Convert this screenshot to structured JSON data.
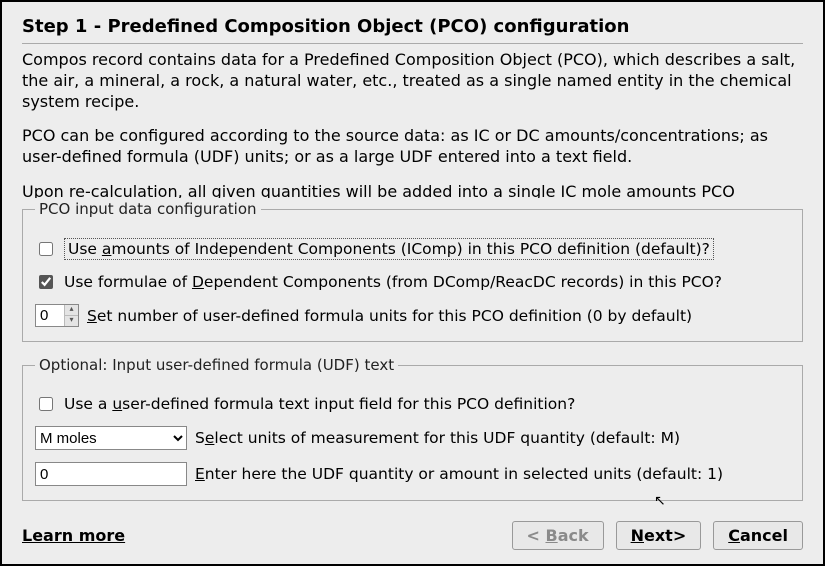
{
  "title": "Step 1 - Predefined Composition Object (PCO) configuration",
  "descr": {
    "p1": "Compos record contains data for a Predefined Composition Object (PCO), which describes a salt, the air, a mineral, a rock, a natural water, etc., treated  as a single named entity in the chemical system recipe.",
    "p2": "PCO can be configured according to the source data: as IC or DC amounts/concentrations; as user-defined formula (UDF) units; or as a large UDF entered into a text field.",
    "p3": "Upon re-calculation, all given quantities will be added into a single IC mole amounts PCO"
  },
  "group1": {
    "legend": "PCO input data configuration",
    "cb_amounts": {
      "checked": false,
      "pre": "Use ",
      "ukey": "a",
      "post": "mounts of Independent Components (IComp) in this PCO definition (default)?"
    },
    "cb_formulae": {
      "checked": true,
      "pre": "Use formulae of ",
      "ukey": "D",
      "post": "ependent Components (from DComp/ReacDC records) in this PCO?"
    },
    "spin": {
      "value": "0",
      "pre": "",
      "ukey": "S",
      "post": "et number of user-defined formula units for this PCO definition (0 by default)"
    }
  },
  "group2": {
    "legend": "Optional: Input user-defined formula (UDF) text",
    "cb_udf": {
      "checked": false,
      "pre": "Use a ",
      "ukey": "u",
      "post": "ser-defined formula text input field for this PCO definition?"
    },
    "units": {
      "selected": "M   moles",
      "pre": "S",
      "ukey": "e",
      "post": "lect units of measurement for this UDF quantity  (default: M)"
    },
    "qty": {
      "value": "0",
      "pre": "",
      "ukey": "E",
      "post": "nter here the UDF quantity or amount in selected units (default: 1)"
    }
  },
  "footer": {
    "learn": "Learn more",
    "back": {
      "pre": "< ",
      "ukey": "B",
      "post": "ack"
    },
    "next": {
      "pre": "",
      "ukey": "N",
      "post": "ext>"
    },
    "cancel": {
      "pre": "",
      "ukey": "C",
      "post": "ancel"
    }
  }
}
